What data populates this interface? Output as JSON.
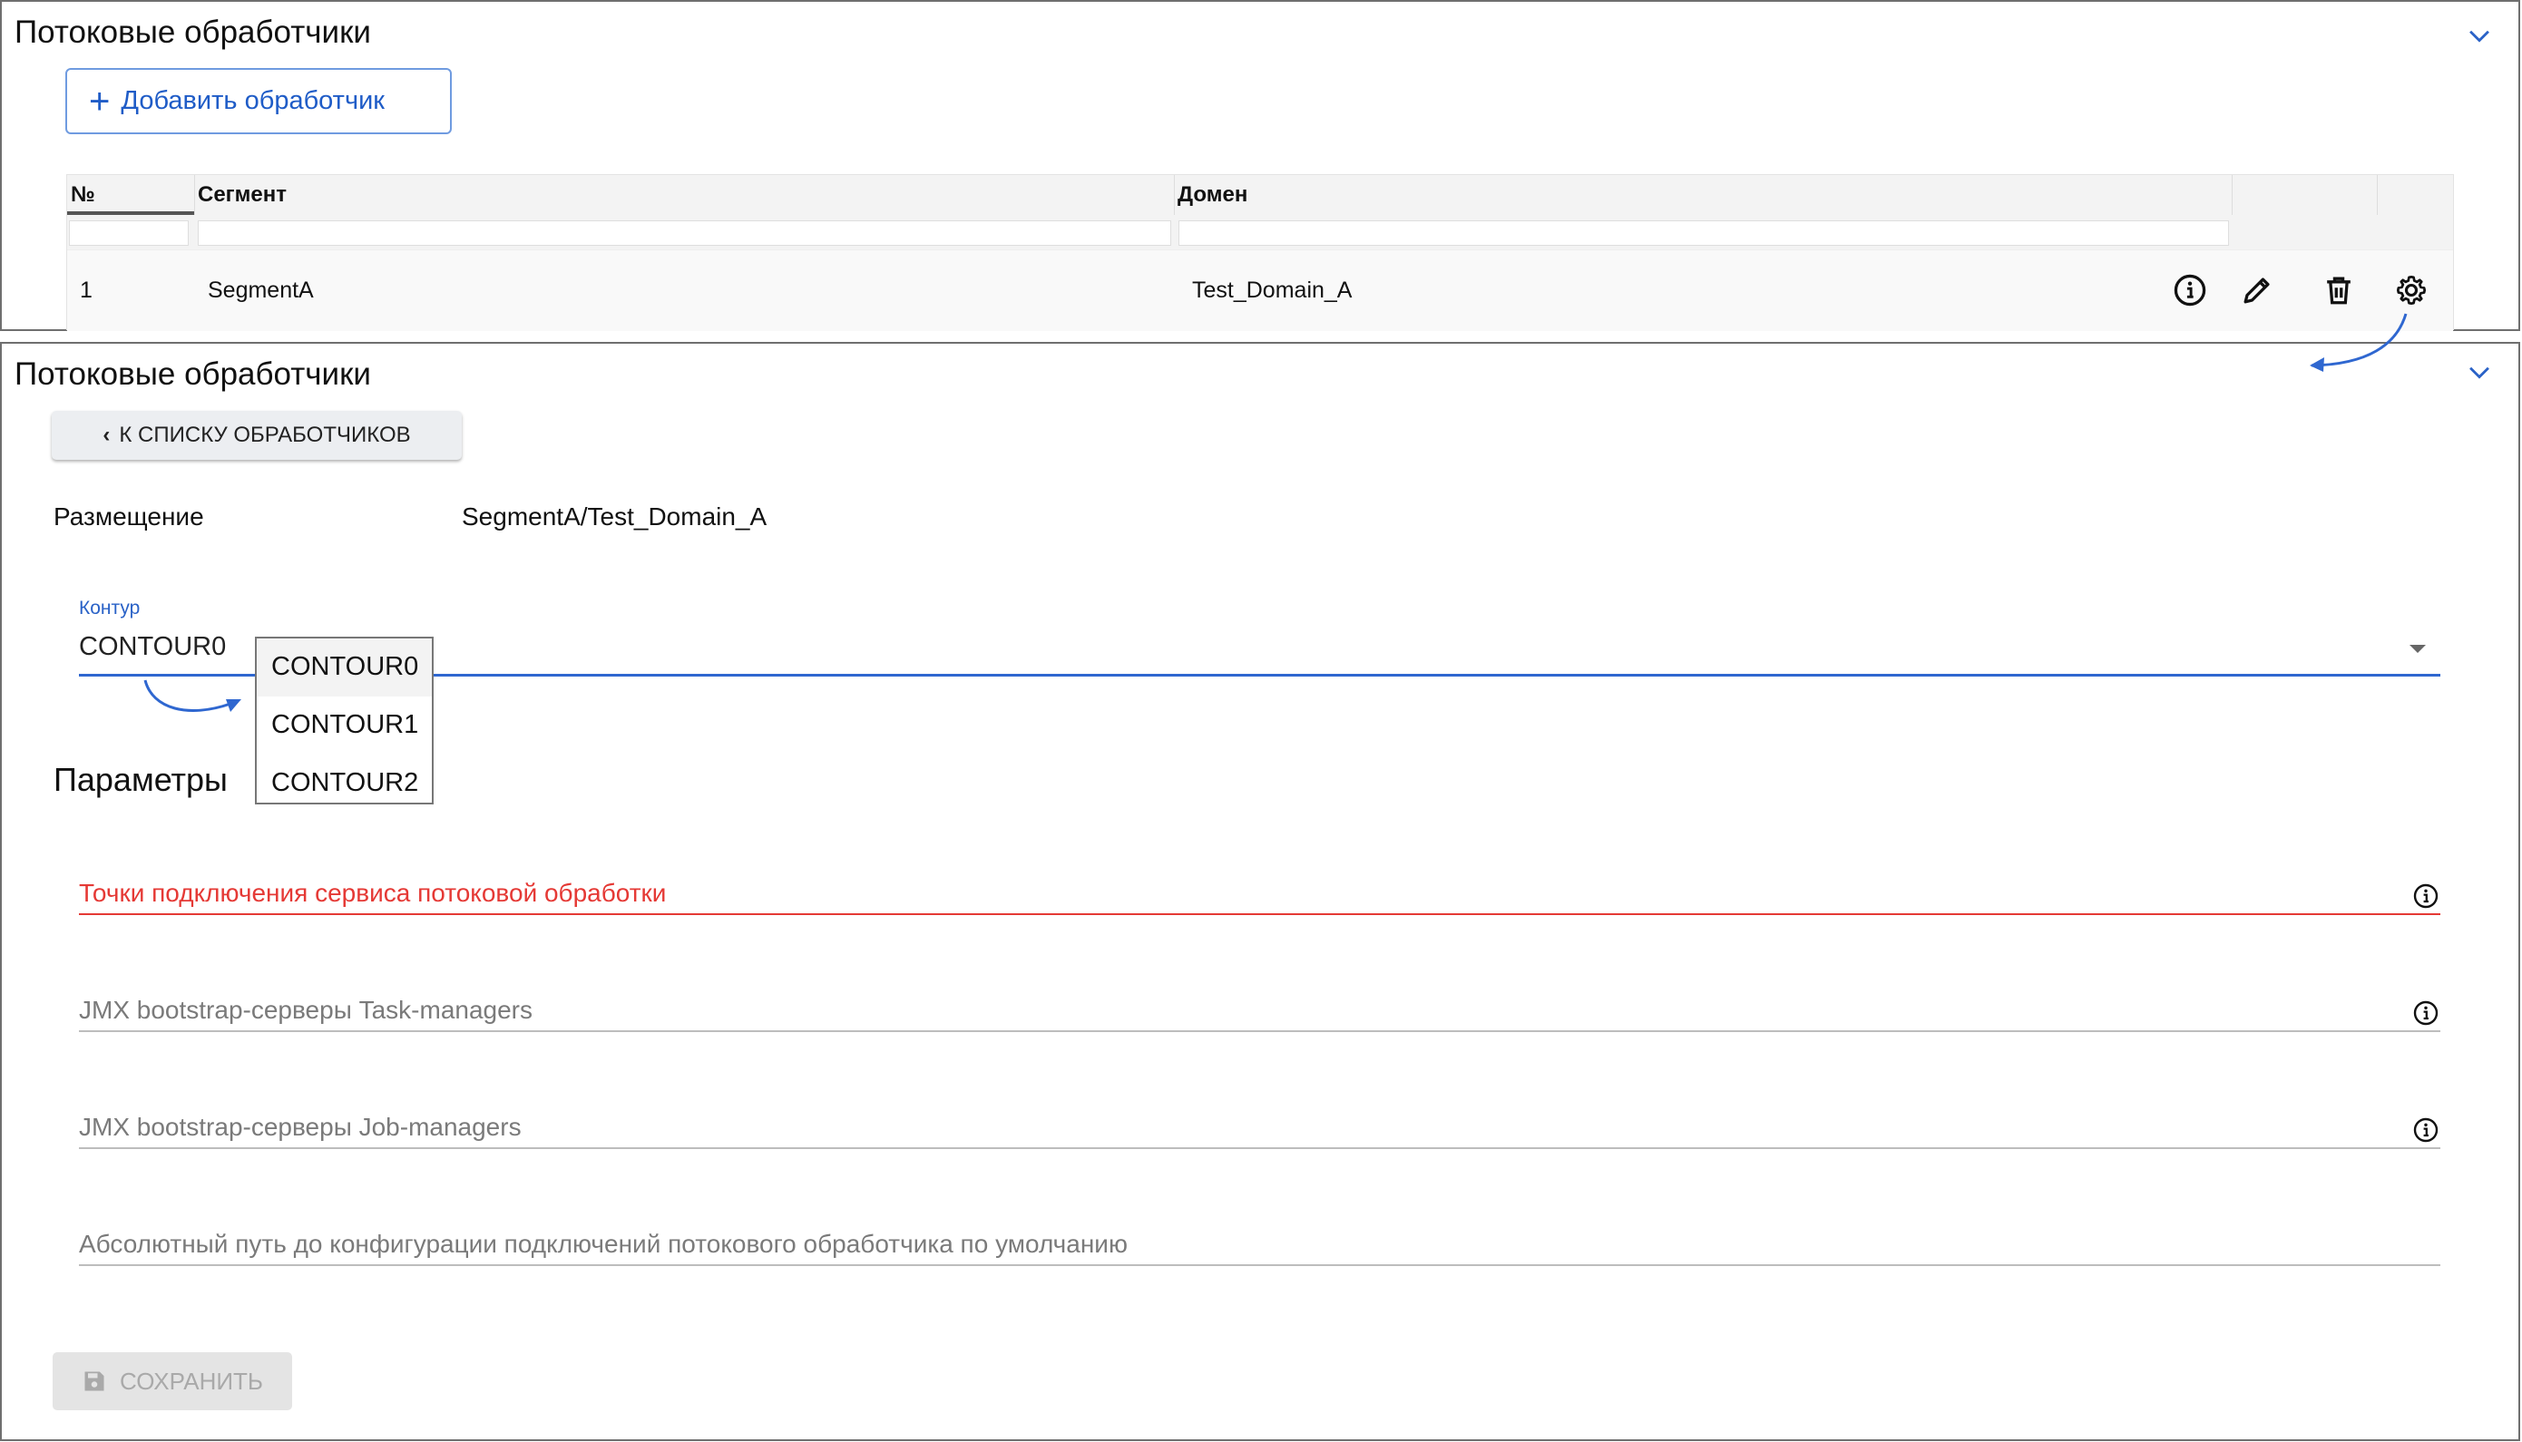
{
  "list_panel": {
    "title": "Потоковые обработчики",
    "add_button_label": "Добавить обработчик",
    "columns": [
      "№",
      "Сегмент",
      "Домен"
    ],
    "rows": [
      {
        "num": "1",
        "segment": "SegmentA",
        "domain": "Test_Domain_A"
      }
    ]
  },
  "detail_panel": {
    "title": "Потоковые обработчики",
    "back_button_label": "К СПИСКУ ОБРАБОТЧИКОВ",
    "placement_label": "Размещение",
    "placement_value": "SegmentA/Test_Domain_A",
    "contour": {
      "label": "Контур",
      "value": "CONTOUR0",
      "options": [
        "CONTOUR0",
        "CONTOUR1",
        "CONTOUR2"
      ]
    },
    "params_heading": "Параметры",
    "fields": [
      {
        "placeholder": "Точки подключения сервиса потоковой обработки",
        "error": true
      },
      {
        "placeholder": "JMX bootstrap-серверы Task-managers"
      },
      {
        "placeholder": "JMX bootstrap-серверы Job-managers"
      },
      {
        "placeholder": "Абсолютный путь до конфигурации подключений потокового обработчика по умолчанию"
      }
    ],
    "save_button_label": "СОХРАНИТЬ"
  },
  "colors": {
    "accent": "#2361c7",
    "error": "#e53935",
    "annotation_arrow": "#2f67d0"
  }
}
